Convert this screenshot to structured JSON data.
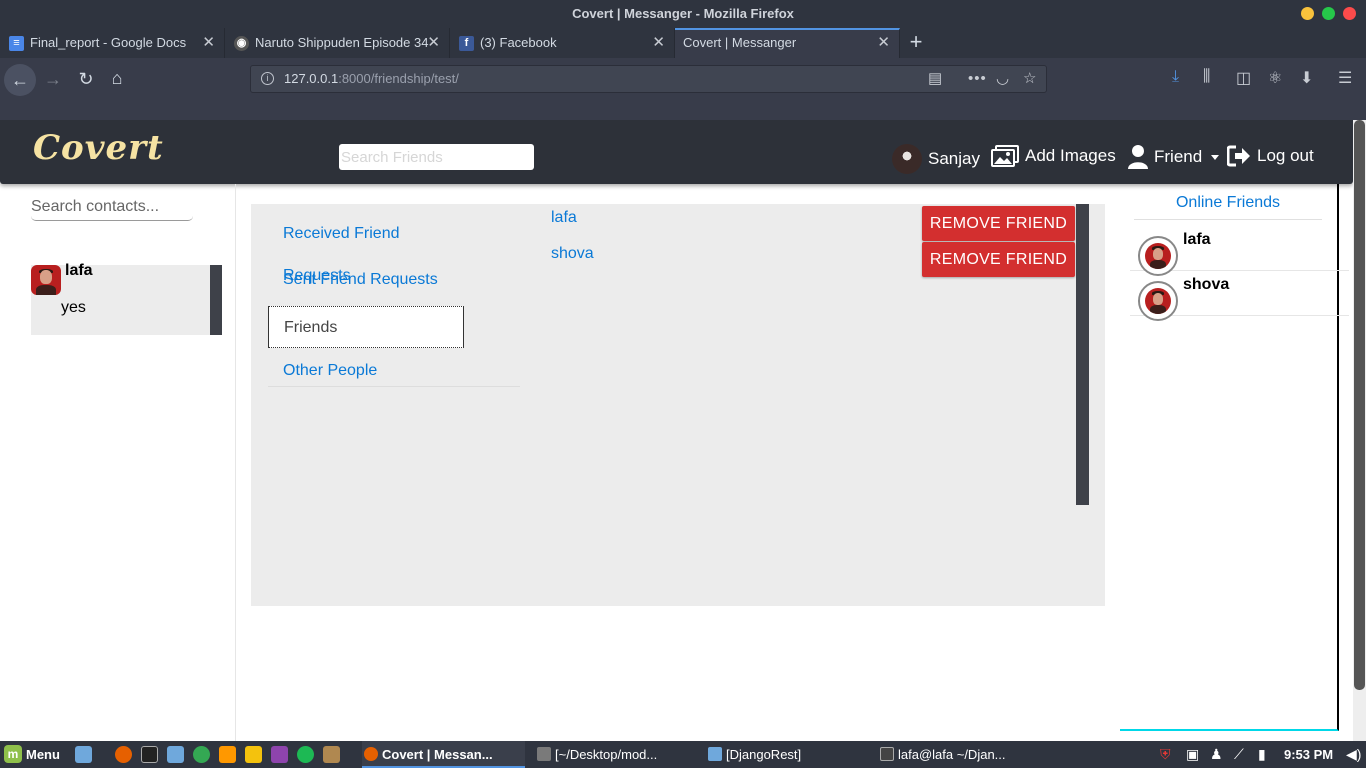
{
  "window": {
    "title": "Covert | Messanger - Mozilla Firefox",
    "controls": {
      "minimize_color": "#f9c23c",
      "maximize_color": "#26c84a",
      "close_color": "#fc4b4b"
    }
  },
  "browser": {
    "tabs": [
      {
        "label": "Final_report - Google Docs",
        "icon": "google-docs-icon",
        "icon_color": "#4a86e8"
      },
      {
        "label": "Naruto Shippuden Episode 34",
        "icon": "naruto-icon",
        "icon_color": "#555555"
      },
      {
        "label": "(3) Facebook",
        "icon": "facebook-icon",
        "icon_color": "#3b5998"
      },
      {
        "label": "Covert | Messanger",
        "icon": "",
        "icon_color": ""
      }
    ],
    "new_tab": "+",
    "url_host": "127.0.0.1",
    "url_path": ":8000/friendship/test/"
  },
  "app": {
    "logo": "Covert",
    "search_friends_placeholder": "Search Friends",
    "user_name": "Sanjay",
    "add_images": "Add Images",
    "friend_menu": "Friend",
    "logout": "Log out"
  },
  "contacts": {
    "search_placeholder": "Search contacts...",
    "items": [
      {
        "name": "lafa",
        "last_message": "yes"
      }
    ]
  },
  "friendship": {
    "menu": [
      {
        "label": "Received Friend Requests"
      },
      {
        "label": "Sent Friend Requests"
      },
      {
        "label": "Friends"
      },
      {
        "label": "Other People"
      }
    ],
    "active_menu": "Friends",
    "friends": [
      {
        "name": "lafa",
        "action": "REMOVE FRIEND"
      },
      {
        "name": "shova",
        "action": "REMOVE FRIEND"
      }
    ]
  },
  "online": {
    "title": "Online Friends",
    "items": [
      {
        "name": "lafa"
      },
      {
        "name": "shova"
      }
    ]
  },
  "taskbar": {
    "menu_label": "Menu",
    "tasks": [
      {
        "label": "Covert | Messan...",
        "icon": "firefox-icon",
        "icon_color": "#e66000"
      },
      {
        "label": "[~/Desktop/mod...",
        "icon": "sublime-icon",
        "icon_color": "#7a7a7a"
      },
      {
        "label": "[DjangoRest]",
        "icon": "folder-icon",
        "icon_color": "#6fa8dc"
      },
      {
        "label": "lafa@lafa ~/Djan...",
        "icon": "terminal-icon",
        "icon_color": "#444444"
      }
    ],
    "clock": "9:53 PM"
  },
  "colors": {
    "accent": "#0a79d6",
    "danger": "#d32f2f",
    "header_bg": "#2d3139",
    "panel_bg": "#ececec"
  }
}
